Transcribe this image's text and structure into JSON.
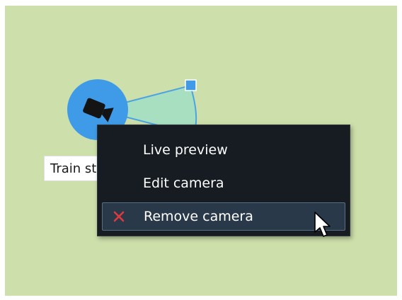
{
  "camera": {
    "label": "Train st",
    "icon": "video-camera-icon",
    "marker_color": "#3f9be8",
    "fov_color": "#a8dfc0"
  },
  "context_menu": {
    "items": [
      {
        "label": "Live preview",
        "icon": "",
        "highlighted": false
      },
      {
        "label": "Edit camera",
        "icon": "",
        "highlighted": false
      },
      {
        "label": "Remove camera",
        "icon": "close-icon",
        "highlighted": true
      }
    ]
  },
  "colors": {
    "map_background": "#cddfaa",
    "menu_background": "#161c22",
    "remove_icon": "#e0393e"
  }
}
